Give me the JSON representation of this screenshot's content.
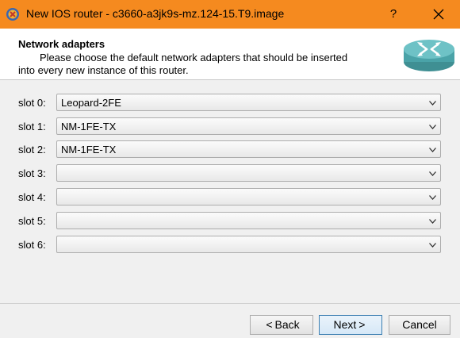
{
  "window": {
    "title": "New IOS router - c3660-a3jk9s-mz.124-15.T9.image",
    "help_label": "?",
    "app_icon": "app-logo-icon",
    "titlebar_color": "#f58a1f"
  },
  "header": {
    "title": "Network adapters",
    "subtitle_line1": "Please choose the default network adapters that should be inserted",
    "subtitle_line2": "into every new instance of this router.",
    "icon": "router-icon"
  },
  "slots": [
    {
      "label": "slot 0:",
      "value": "Leopard-2FE"
    },
    {
      "label": "slot 1:",
      "value": "NM-1FE-TX"
    },
    {
      "label": "slot 2:",
      "value": "NM-1FE-TX"
    },
    {
      "label": "slot 3:",
      "value": ""
    },
    {
      "label": "slot 4:",
      "value": ""
    },
    {
      "label": "slot 5:",
      "value": ""
    },
    {
      "label": "slot 6:",
      "value": ""
    }
  ],
  "buttons": {
    "back_prefix": "<",
    "back_label": "Back",
    "next_label": "Next",
    "next_suffix": ">",
    "cancel_label": "Cancel"
  }
}
